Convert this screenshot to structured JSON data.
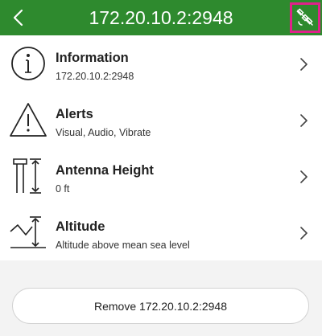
{
  "header": {
    "title": "172.20.10.2:2948",
    "back_icon": "chevron-left-icon",
    "action_icon": "satellite-off-icon",
    "bg_color": "#2e8a2e",
    "highlight_color": "#e0218a"
  },
  "rows": [
    {
      "title": "Information",
      "subtitle": "172.20.10.2:2948",
      "icon": "info-circle-icon"
    },
    {
      "title": "Alerts",
      "subtitle": "Visual, Audio, Vibrate",
      "icon": "warning-triangle-icon"
    },
    {
      "title": "Antenna Height",
      "subtitle": "0 ft",
      "icon": "antenna-height-icon"
    },
    {
      "title": "Altitude",
      "subtitle": "Altitude above mean sea level",
      "icon": "altitude-icon"
    }
  ],
  "remove_button": {
    "label": "Remove 172.20.10.2:2948"
  }
}
